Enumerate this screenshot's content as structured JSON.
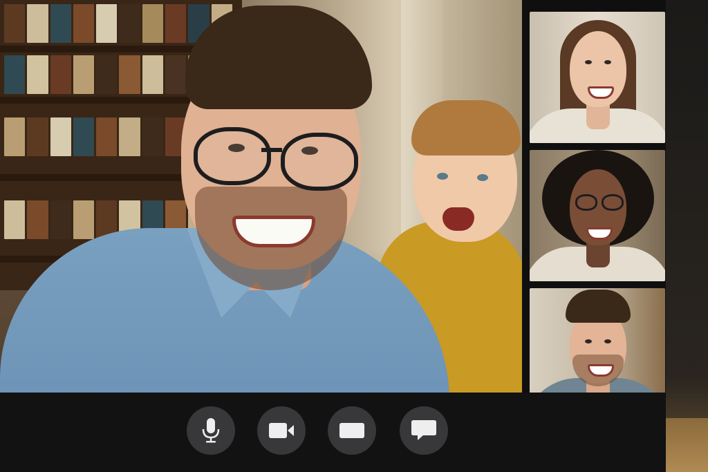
{
  "window": {
    "title": ""
  },
  "colors": {
    "control_bar": "#121213",
    "button_bg": "#38383a",
    "icon": "#eeeeee",
    "sidebar": "#0f0f10"
  },
  "main_video": {
    "participants": [
      "man-with-glasses",
      "child"
    ]
  },
  "participants_sidebar": {
    "tiles": [
      {
        "kind": "woman-smiling"
      },
      {
        "kind": "woman-curly-hair-glasses"
      },
      {
        "kind": "man-smiling"
      }
    ]
  },
  "controls": [
    {
      "id": "microphone",
      "icon": "microphone-icon"
    },
    {
      "id": "camera",
      "icon": "video-camera-icon"
    },
    {
      "id": "screen",
      "icon": "screen-share-icon"
    },
    {
      "id": "chat",
      "icon": "chat-bubble-icon"
    }
  ]
}
